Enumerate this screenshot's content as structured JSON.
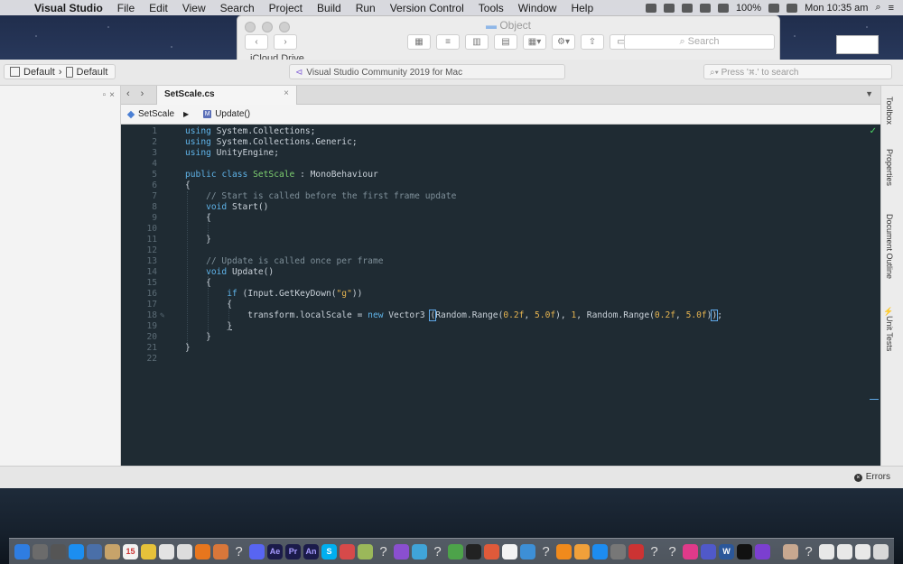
{
  "menubar": {
    "app_name": "Visual Studio",
    "items": [
      "File",
      "Edit",
      "View",
      "Search",
      "Project",
      "Build",
      "Run",
      "Version Control",
      "Tools",
      "Window",
      "Help"
    ],
    "battery": "100%",
    "clock": "Mon 10:35 am"
  },
  "finder": {
    "title": "Object",
    "search_placeholder": "Search",
    "sidebar_item": "iCloud Drive"
  },
  "toolbar": {
    "config_label": "Default",
    "device_label": "Default",
    "status_text": "Visual Studio Community 2019 for Mac",
    "search_placeholder": "Press '⌘.' to search"
  },
  "tab": {
    "file_name": "SetScale.cs",
    "close_glyph": "×"
  },
  "breadcrumb": {
    "class_name": "SetScale",
    "method_name": "Update()"
  },
  "editor": {
    "line_numbers": [
      "1",
      "2",
      "3",
      "4",
      "5",
      "6",
      "7",
      "8",
      "9",
      "10",
      "11",
      "12",
      "13",
      "14",
      "15",
      "16",
      "17",
      "18",
      "19",
      "20",
      "21",
      "22"
    ]
  },
  "right_pads": {
    "toolbox": "Toolbox",
    "properties": "Properties",
    "document_outline": "Document Outline",
    "unit_tests": "Unit Tests"
  },
  "statusbar": {
    "errors_label": "Errors"
  },
  "colors": {
    "editor_bg": "#1f2b33",
    "keyword": "#5fb3e8",
    "class": "#7ed070",
    "comment": "#7e8f99",
    "string": "#e6b450"
  }
}
